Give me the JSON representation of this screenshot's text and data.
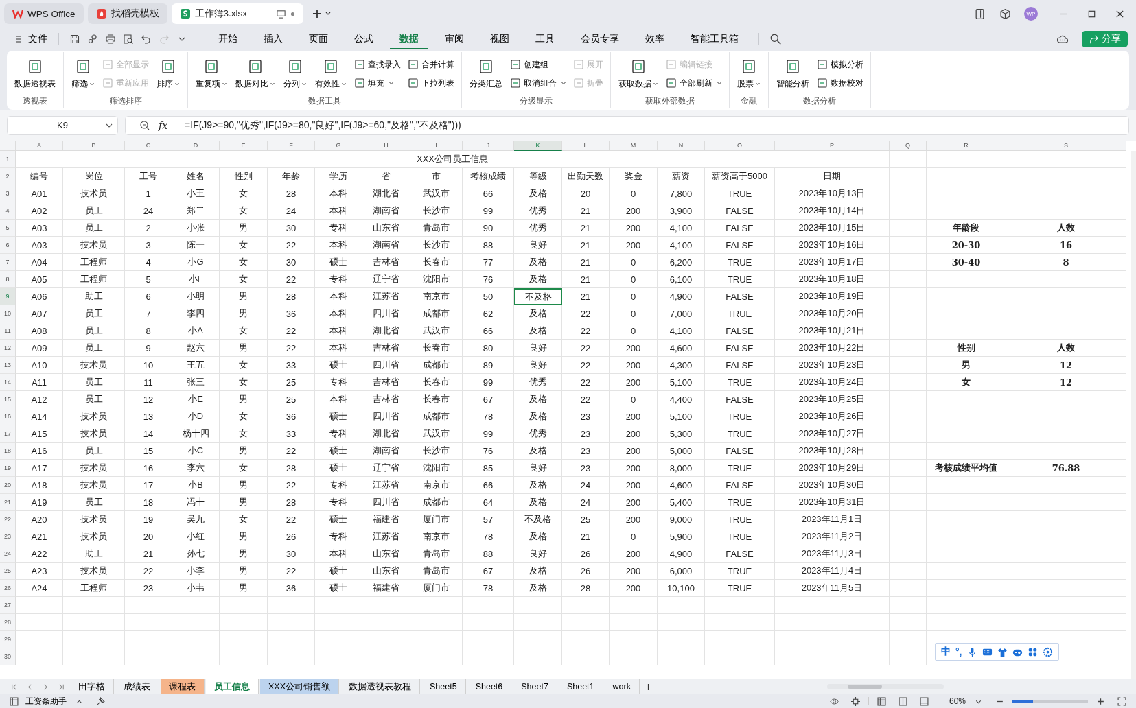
{
  "window_tabs": [
    {
      "label": "WPS Office",
      "kind": "wps",
      "selected": false
    },
    {
      "label": "找稻壳模板",
      "kind": "docer",
      "selected": false
    },
    {
      "label": "工作簿3.xlsx",
      "kind": "sheet",
      "selected": true
    }
  ],
  "avatar": "WP",
  "menu": {
    "file": "文件",
    "quick_tools": [
      {
        "kind": "save",
        "disabled": false
      },
      {
        "kind": "link",
        "disabled": false
      },
      {
        "kind": "print",
        "disabled": false
      },
      {
        "kind": "preview",
        "disabled": false
      },
      {
        "kind": "undo",
        "disabled": false
      },
      {
        "kind": "redo",
        "disabled": true
      }
    ],
    "tabs": [
      {
        "label": "开始",
        "selected": false
      },
      {
        "label": "插入",
        "selected": false
      },
      {
        "label": "页面",
        "selected": false
      },
      {
        "label": "公式",
        "selected": false
      },
      {
        "label": "数据",
        "selected": true
      },
      {
        "label": "审阅",
        "selected": false
      },
      {
        "label": "视图",
        "selected": false
      },
      {
        "label": "工具",
        "selected": false
      },
      {
        "label": "会员专享",
        "selected": false
      },
      {
        "label": "效率",
        "selected": false
      },
      {
        "label": "智能工具箱",
        "selected": false
      }
    ],
    "share": "分享"
  },
  "ribbon": [
    {
      "title": "透视表",
      "items": [
        {
          "label": "数据透视表",
          "kind": "large",
          "dropdown": false,
          "disabled": false
        }
      ]
    },
    {
      "title": "筛选排序",
      "items": [
        {
          "label": "筛选",
          "kind": "large",
          "dropdown": true,
          "disabled": false
        },
        {
          "label": "全部显示",
          "kind": "small",
          "dropdown": false,
          "disabled": true
        },
        {
          "label": "重新应用",
          "kind": "small",
          "dropdown": false,
          "disabled": true
        },
        {
          "label": "排序",
          "kind": "large",
          "dropdown": true,
          "disabled": false
        }
      ]
    },
    {
      "title": "数据工具",
      "items": [
        {
          "label": "重复项",
          "kind": "large",
          "dropdown": true,
          "disabled": false
        },
        {
          "label": "数据对比",
          "kind": "large",
          "dropdown": true,
          "disabled": false
        },
        {
          "label": "分列",
          "kind": "large",
          "dropdown": true,
          "disabled": false
        },
        {
          "label": "有效性",
          "kind": "large",
          "dropdown": true,
          "disabled": false
        },
        {
          "label": "查找录入",
          "kind": "small",
          "dropdown": false,
          "disabled": false
        },
        {
          "label": "填充",
          "kind": "small",
          "dropdown": true,
          "disabled": false
        },
        {
          "label": "合并计算",
          "kind": "small",
          "dropdown": false,
          "disabled": false
        },
        {
          "label": "下拉列表",
          "kind": "small",
          "dropdown": false,
          "disabled": false
        }
      ]
    },
    {
      "title": "分级显示",
      "items": [
        {
          "label": "分类汇总",
          "kind": "large",
          "dropdown": false,
          "disabled": false
        },
        {
          "label": "创建组",
          "kind": "small",
          "dropdown": false,
          "disabled": false
        },
        {
          "label": "取消组合",
          "kind": "small",
          "dropdown": true,
          "disabled": false
        },
        {
          "label": "展开",
          "kind": "small",
          "dropdown": false,
          "disabled": true
        },
        {
          "label": "折叠",
          "kind": "small",
          "dropdown": false,
          "disabled": true
        }
      ]
    },
    {
      "title": "获取外部数据",
      "items": [
        {
          "label": "获取数据",
          "kind": "large",
          "dropdown": true,
          "disabled": false
        },
        {
          "label": "编辑链接",
          "kind": "small",
          "dropdown": false,
          "disabled": true
        },
        {
          "label": "全部刷新",
          "kind": "small",
          "dropdown": true,
          "disabled": false
        }
      ]
    },
    {
      "title": "金融",
      "items": [
        {
          "label": "股票",
          "kind": "large",
          "dropdown": true,
          "disabled": false
        }
      ]
    },
    {
      "title": "数据分析",
      "items": [
        {
          "label": "智能分析",
          "kind": "large",
          "dropdown": false,
          "disabled": false
        },
        {
          "label": "模拟分析",
          "kind": "small",
          "dropdown": false,
          "disabled": false
        },
        {
          "label": "数据校对",
          "kind": "small",
          "dropdown": false,
          "disabled": false
        }
      ]
    }
  ],
  "name_box": "K9",
  "fx": "fx",
  "formula": "=IF(J9>=90,\"优秀\",IF(J9>=80,\"良好\",IF(J9>=60,\"及格\",\"不及格\")))",
  "columns": [
    {
      "letter": "A",
      "selected": false
    },
    {
      "letter": "B",
      "selected": false
    },
    {
      "letter": "C",
      "selected": false
    },
    {
      "letter": "D",
      "selected": false
    },
    {
      "letter": "E",
      "selected": false
    },
    {
      "letter": "F",
      "selected": false
    },
    {
      "letter": "G",
      "selected": false
    },
    {
      "letter": "H",
      "selected": false
    },
    {
      "letter": "I",
      "selected": false
    },
    {
      "letter": "J",
      "selected": false
    },
    {
      "letter": "K",
      "selected": true
    },
    {
      "letter": "L",
      "selected": false
    },
    {
      "letter": "M",
      "selected": false
    },
    {
      "letter": "N",
      "selected": false
    },
    {
      "letter": "O",
      "selected": false
    },
    {
      "letter": "P",
      "selected": false
    },
    {
      "letter": "Q",
      "selected": false
    },
    {
      "letter": "R",
      "selected": false
    },
    {
      "letter": "S",
      "selected": false
    }
  ],
  "rows": [
    {
      "number": "1",
      "selected": false,
      "title": "XXX公司员工信息"
    },
    {
      "number": "2",
      "selected": false,
      "cells": [
        "编号",
        "岗位",
        "工号",
        "姓名",
        "性别",
        "年龄",
        "学历",
        "省",
        "市",
        "考核成绩",
        "等级",
        "出勤天数",
        "奖金",
        "薪资",
        "薪资高于5000",
        "日期"
      ]
    },
    {
      "number": "3",
      "selected": false,
      "cells": [
        "A01",
        "技术员",
        "1",
        "小王",
        "女",
        "28",
        "本科",
        "湖北省",
        "武汉市",
        "66",
        "及格",
        "20",
        "0",
        "7,800",
        "TRUE",
        "2023年10月13日"
      ]
    },
    {
      "number": "4",
      "selected": false,
      "cells": [
        "A02",
        "员工",
        "24",
        "郑二",
        "女",
        "24",
        "本科",
        "湖南省",
        "长沙市",
        "99",
        "优秀",
        "21",
        "200",
        "3,900",
        "FALSE",
        "2023年10月14日"
      ]
    },
    {
      "number": "5",
      "selected": false,
      "cells": [
        "A03",
        "员工",
        "2",
        "小张",
        "男",
        "30",
        "专科",
        "山东省",
        "青岛市",
        "90",
        "优秀",
        "21",
        "200",
        "4,100",
        "FALSE",
        "2023年10月15日"
      ],
      "side": [
        "年龄段",
        "人数"
      ]
    },
    {
      "number": "6",
      "selected": false,
      "cells": [
        "A03",
        "技术员",
        "3",
        "陈一",
        "女",
        "22",
        "本科",
        "湖南省",
        "长沙市",
        "88",
        "良好",
        "21",
        "200",
        "4,100",
        "FALSE",
        "2023年10月16日"
      ],
      "side": [
        "20-30",
        "16"
      ]
    },
    {
      "number": "7",
      "selected": false,
      "cells": [
        "A04",
        "工程师",
        "4",
        "小G",
        "女",
        "30",
        "硕士",
        "吉林省",
        "长春市",
        "77",
        "及格",
        "21",
        "0",
        "6,200",
        "TRUE",
        "2023年10月17日"
      ],
      "side": [
        "30-40",
        "8"
      ]
    },
    {
      "number": "8",
      "selected": false,
      "cells": [
        "A05",
        "工程师",
        "5",
        "小F",
        "女",
        "22",
        "专科",
        "辽宁省",
        "沈阳市",
        "76",
        "及格",
        "21",
        "0",
        "6,100",
        "TRUE",
        "2023年10月18日"
      ]
    },
    {
      "number": "9",
      "selected": true,
      "cells": [
        "A06",
        "助工",
        "6",
        "小明",
        "男",
        "28",
        "本科",
        "江苏省",
        "南京市",
        "50",
        "不及格",
        "21",
        "0",
        "4,900",
        "FALSE",
        "2023年10月19日"
      ]
    },
    {
      "number": "10",
      "selected": false,
      "cells": [
        "A07",
        "员工",
        "7",
        "李四",
        "男",
        "36",
        "本科",
        "四川省",
        "成都市",
        "62",
        "及格",
        "22",
        "0",
        "7,000",
        "TRUE",
        "2023年10月20日"
      ]
    },
    {
      "number": "11",
      "selected": false,
      "cells": [
        "A08",
        "员工",
        "8",
        "小A",
        "女",
        "22",
        "本科",
        "湖北省",
        "武汉市",
        "66",
        "及格",
        "22",
        "0",
        "4,100",
        "FALSE",
        "2023年10月21日"
      ]
    },
    {
      "number": "12",
      "selected": false,
      "cells": [
        "A09",
        "员工",
        "9",
        "赵六",
        "男",
        "22",
        "本科",
        "吉林省",
        "长春市",
        "80",
        "良好",
        "22",
        "200",
        "4,600",
        "FALSE",
        "2023年10月22日"
      ],
      "side": [
        "性别",
        "人数"
      ]
    },
    {
      "number": "13",
      "selected": false,
      "cells": [
        "A10",
        "技术员",
        "10",
        "王五",
        "女",
        "33",
        "硕士",
        "四川省",
        "成都市",
        "89",
        "良好",
        "22",
        "200",
        "4,300",
        "FALSE",
        "2023年10月23日"
      ],
      "side": [
        "男",
        "12"
      ]
    },
    {
      "number": "14",
      "selected": false,
      "cells": [
        "A11",
        "员工",
        "11",
        "张三",
        "女",
        "25",
        "专科",
        "吉林省",
        "长春市",
        "99",
        "优秀",
        "22",
        "200",
        "5,100",
        "TRUE",
        "2023年10月24日"
      ],
      "side": [
        "女",
        "12"
      ]
    },
    {
      "number": "15",
      "selected": false,
      "cells": [
        "A12",
        "员工",
        "12",
        "小E",
        "男",
        "25",
        "本科",
        "吉林省",
        "长春市",
        "67",
        "及格",
        "22",
        "0",
        "4,400",
        "FALSE",
        "2023年10月25日"
      ]
    },
    {
      "number": "16",
      "selected": false,
      "cells": [
        "A14",
        "技术员",
        "13",
        "小D",
        "女",
        "36",
        "硕士",
        "四川省",
        "成都市",
        "78",
        "及格",
        "23",
        "200",
        "5,100",
        "TRUE",
        "2023年10月26日"
      ]
    },
    {
      "number": "17",
      "selected": false,
      "cells": [
        "A15",
        "技术员",
        "14",
        "杨十四",
        "女",
        "33",
        "专科",
        "湖北省",
        "武汉市",
        "99",
        "优秀",
        "23",
        "200",
        "5,300",
        "TRUE",
        "2023年10月27日"
      ]
    },
    {
      "number": "18",
      "selected": false,
      "cells": [
        "A16",
        "员工",
        "15",
        "小C",
        "男",
        "22",
        "硕士",
        "湖南省",
        "长沙市",
        "76",
        "及格",
        "23",
        "200",
        "5,000",
        "FALSE",
        "2023年10月28日"
      ]
    },
    {
      "number": "19",
      "selected": false,
      "cells": [
        "A17",
        "技术员",
        "16",
        "李六",
        "女",
        "28",
        "硕士",
        "辽宁省",
        "沈阳市",
        "85",
        "良好",
        "23",
        "200",
        "8,000",
        "TRUE",
        "2023年10月29日"
      ],
      "side": [
        "考核成绩平均值",
        "76.88"
      ]
    },
    {
      "number": "20",
      "selected": false,
      "cells": [
        "A18",
        "技术员",
        "17",
        "小B",
        "男",
        "22",
        "专科",
        "江苏省",
        "南京市",
        "66",
        "及格",
        "24",
        "200",
        "4,600",
        "FALSE",
        "2023年10月30日"
      ]
    },
    {
      "number": "21",
      "selected": false,
      "cells": [
        "A19",
        "员工",
        "18",
        "冯十",
        "男",
        "28",
        "专科",
        "四川省",
        "成都市",
        "64",
        "及格",
        "24",
        "200",
        "5,400",
        "TRUE",
        "2023年10月31日"
      ]
    },
    {
      "number": "22",
      "selected": false,
      "cells": [
        "A20",
        "技术员",
        "19",
        "吴九",
        "女",
        "22",
        "硕士",
        "福建省",
        "厦门市",
        "57",
        "不及格",
        "25",
        "200",
        "9,000",
        "TRUE",
        "2023年11月1日"
      ]
    },
    {
      "number": "23",
      "selected": false,
      "cells": [
        "A21",
        "技术员",
        "20",
        "小红",
        "男",
        "26",
        "专科",
        "江苏省",
        "南京市",
        "78",
        "及格",
        "21",
        "0",
        "5,900",
        "TRUE",
        "2023年11月2日"
      ]
    },
    {
      "number": "24",
      "selected": false,
      "cells": [
        "A22",
        "助工",
        "21",
        "孙七",
        "男",
        "30",
        "本科",
        "山东省",
        "青岛市",
        "88",
        "良好",
        "26",
        "200",
        "4,900",
        "FALSE",
        "2023年11月3日"
      ]
    },
    {
      "number": "25",
      "selected": false,
      "cells": [
        "A23",
        "技术员",
        "22",
        "小李",
        "男",
        "22",
        "硕士",
        "山东省",
        "青岛市",
        "67",
        "及格",
        "26",
        "200",
        "6,000",
        "TRUE",
        "2023年11月4日"
      ]
    },
    {
      "number": "26",
      "selected": false,
      "cells": [
        "A24",
        "工程师",
        "23",
        "小韦",
        "男",
        "36",
        "硕士",
        "福建省",
        "厦门市",
        "78",
        "及格",
        "28",
        "200",
        "10,100",
        "TRUE",
        "2023年11月5日"
      ]
    },
    {
      "number": "27",
      "selected": false
    },
    {
      "number": "28",
      "selected": false
    },
    {
      "number": "29",
      "selected": false
    },
    {
      "number": "30",
      "selected": false
    }
  ],
  "ime_bar": [
    "中",
    "°,"
  ],
  "sheet_tabs": [
    {
      "label": "田字格",
      "selected": false
    },
    {
      "label": "成绩表",
      "selected": false
    },
    {
      "label": "课程表",
      "selected": false,
      "color": "#f5b48a"
    },
    {
      "label": "员工信息",
      "selected": true
    },
    {
      "label": "XXX公司销售额",
      "selected": false,
      "color": "#bcd3ee"
    },
    {
      "label": "数据透视表教程",
      "selected": false
    },
    {
      "label": "Sheet5",
      "selected": false
    },
    {
      "label": "Sheet6",
      "selected": false
    },
    {
      "label": "Sheet7",
      "selected": false
    },
    {
      "label": "Sheet1",
      "selected": false
    },
    {
      "label": "work",
      "selected": false
    }
  ],
  "status_bar": {
    "assistant": "工资条助手",
    "zoom": "60%",
    "level": 0.27
  }
}
